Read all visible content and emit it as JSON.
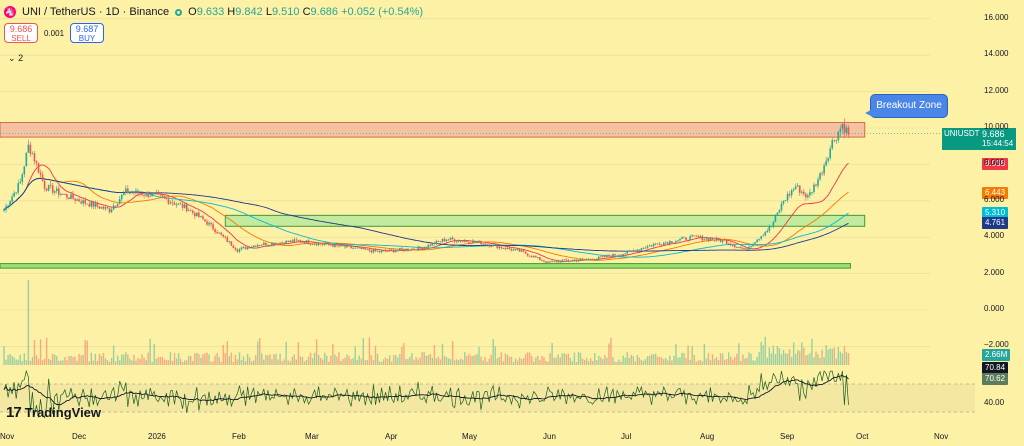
{
  "header": {
    "logo_icon": "uniswap-icon",
    "symbol": "UNI / TetherUS · 1D · Binance",
    "open_label": "O",
    "open": "9.633",
    "high_label": "H",
    "high": "9.842",
    "low_label": "L",
    "low": "9.510",
    "close_label": "C",
    "close": "9.686",
    "change": "+0.052 (+0.54%)"
  },
  "trade": {
    "sell_price": "9.686",
    "sell_label": "SELL",
    "spread": "0.001",
    "buy_price": "9.687",
    "buy_label": "BUY"
  },
  "indicators_toggle": {
    "icon": "chevron-down-icon",
    "count": "2"
  },
  "annotation": {
    "label": "Breakout Zone"
  },
  "current_price": {
    "symbol": "UNIUSDT",
    "price": "9.686",
    "countdown": "15:44:54"
  },
  "price_labels": [
    {
      "value": "8.038",
      "color": "#f23645"
    },
    {
      "value": "6.443",
      "color": "#f57c00"
    },
    {
      "value": "5.310",
      "color": "#00bcd4"
    },
    {
      "value": "4.761",
      "color": "#1e3a8a"
    },
    {
      "value": "2.66M",
      "color": "#26a69a"
    },
    {
      "value": "70.84",
      "color": "#131722"
    },
    {
      "value": "70.62",
      "color": "#5c7c5c"
    }
  ],
  "brand": {
    "name": "TradingView",
    "icon": "tradingview-logo-icon"
  },
  "colors": {
    "up": "#26a69a",
    "down": "#ef5350",
    "ma_red": "#f23645",
    "ma_orange": "#f57c00",
    "ma_cyan": "#00bcd4",
    "ma_navy": "#1e3a8a",
    "zone_green": "#aee89a",
    "zone_red": "#f2b1a0",
    "rsi": "#1b5e20"
  },
  "chart_data": {
    "type": "candlestick",
    "x_ticks": [
      "Nov",
      "Dec",
      "2026",
      "Feb",
      "Mar",
      "Apr",
      "May",
      "Jun",
      "Jul",
      "Aug",
      "Sep",
      "Oct",
      "Nov"
    ],
    "y_ticks": [
      "16.000",
      "14.000",
      "12.000",
      "10.000",
      "8.000",
      "6.000",
      "4.000",
      "2.000",
      "0.000",
      "−2.000",
      "40.00"
    ],
    "price_ylim": [
      -3,
      17
    ],
    "close_path": [
      {
        "i": 0,
        "v": 5.5
      },
      {
        "i": 8,
        "v": 7.0
      },
      {
        "i": 12,
        "v": 9.0
      },
      {
        "i": 14,
        "v": 8.6
      },
      {
        "i": 20,
        "v": 6.8
      },
      {
        "i": 30,
        "v": 6.3
      },
      {
        "i": 40,
        "v": 5.9
      },
      {
        "i": 52,
        "v": 5.5
      },
      {
        "i": 60,
        "v": 6.5
      },
      {
        "i": 75,
        "v": 6.3
      },
      {
        "i": 90,
        "v": 5.6
      },
      {
        "i": 100,
        "v": 4.8
      },
      {
        "i": 115,
        "v": 3.3
      },
      {
        "i": 125,
        "v": 3.6
      },
      {
        "i": 145,
        "v": 3.8
      },
      {
        "i": 165,
        "v": 3.5
      },
      {
        "i": 185,
        "v": 3.2
      },
      {
        "i": 205,
        "v": 3.4
      },
      {
        "i": 218,
        "v": 3.9
      },
      {
        "i": 235,
        "v": 3.7
      },
      {
        "i": 255,
        "v": 3.2
      },
      {
        "i": 268,
        "v": 2.6
      },
      {
        "i": 275,
        "v": 2.7
      },
      {
        "i": 290,
        "v": 2.8
      },
      {
        "i": 305,
        "v": 3.1
      },
      {
        "i": 320,
        "v": 3.6
      },
      {
        "i": 340,
        "v": 4.0
      },
      {
        "i": 355,
        "v": 3.8
      },
      {
        "i": 365,
        "v": 3.3
      },
      {
        "i": 378,
        "v": 4.6
      },
      {
        "i": 384,
        "v": 6.0
      },
      {
        "i": 390,
        "v": 6.8
      },
      {
        "i": 396,
        "v": 6.2
      },
      {
        "i": 402,
        "v": 7.4
      },
      {
        "i": 408,
        "v": 9.2
      },
      {
        "i": 413,
        "v": 10.2
      },
      {
        "i": 416,
        "v": 9.686
      }
    ],
    "candle_count": 417,
    "moving_averages": [
      {
        "name": "",
        "color": "#f23645",
        "last": 8.038
      },
      {
        "name": "",
        "color": "#f57c00",
        "last": 6.443
      },
      {
        "name": "",
        "color": "#00bcd4",
        "last": 5.31
      },
      {
        "name": "",
        "color": "#1e3a8a",
        "last": 4.761
      }
    ],
    "zones": [
      {
        "kind": "resistance",
        "from_i": 0,
        "to_i": 424,
        "y_low": 9.5,
        "y_high": 10.3,
        "color": "#f2b1a0"
      },
      {
        "kind": "support",
        "from_i": 111,
        "to_i": 424,
        "y_low": 4.6,
        "y_high": 5.2,
        "color": "#aee89a"
      },
      {
        "kind": "support",
        "from_i": 0,
        "to_i": 417,
        "y_low": 2.3,
        "y_high": 2.55,
        "color": "#7ed957"
      }
    ],
    "volume_last": "2.66M",
    "rsi_last": 70.84,
    "rsi_ma_last": 70.62
  }
}
